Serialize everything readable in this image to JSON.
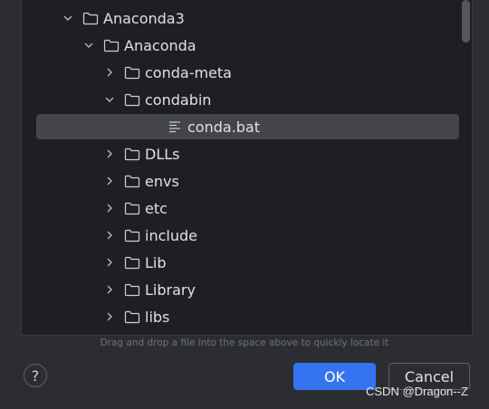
{
  "tree": {
    "rows": [
      {
        "label": "Anaconda3",
        "depth": 0,
        "state": "expanded",
        "type": "folder"
      },
      {
        "label": "Anaconda",
        "depth": 1,
        "state": "expanded",
        "type": "folder"
      },
      {
        "label": "conda-meta",
        "depth": 2,
        "state": "collapsed",
        "type": "folder"
      },
      {
        "label": "condabin",
        "depth": 2,
        "state": "expanded",
        "type": "folder"
      },
      {
        "label": "conda.bat",
        "depth": 3,
        "state": "leaf",
        "type": "file",
        "selected": true
      },
      {
        "label": "DLLs",
        "depth": 2,
        "state": "collapsed",
        "type": "folder"
      },
      {
        "label": "envs",
        "depth": 2,
        "state": "collapsed",
        "type": "folder"
      },
      {
        "label": "etc",
        "depth": 2,
        "state": "collapsed",
        "type": "folder"
      },
      {
        "label": "include",
        "depth": 2,
        "state": "collapsed",
        "type": "folder"
      },
      {
        "label": "Lib",
        "depth": 2,
        "state": "collapsed",
        "type": "folder"
      },
      {
        "label": "Library",
        "depth": 2,
        "state": "collapsed",
        "type": "folder"
      },
      {
        "label": "libs",
        "depth": 2,
        "state": "collapsed",
        "type": "folder"
      }
    ]
  },
  "hint_text": "Drag and drop a file into the space above to quickly locate it",
  "footer": {
    "help_label": "?",
    "ok_label": "OK",
    "cancel_label": "Cancel"
  },
  "watermark": "CSDN @Dragon--Z",
  "colors": {
    "accent": "#3574f0",
    "background": "#2b2d30",
    "tree_background": "#1e1f22",
    "selection": "#43454a"
  },
  "icons": {
    "expanded": "chevron-down-icon",
    "collapsed": "chevron-right-icon",
    "folder": "folder-icon",
    "file": "text-file-icon"
  }
}
